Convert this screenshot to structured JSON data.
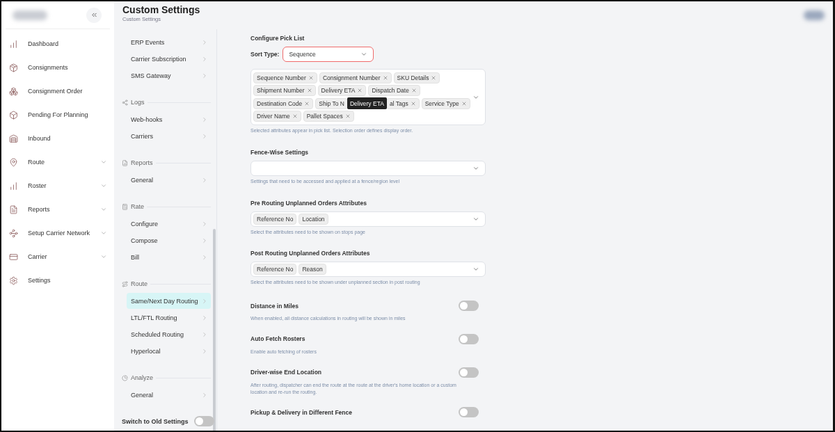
{
  "header": {
    "title": "Custom Settings",
    "breadcrumb": "Custom Settings"
  },
  "sidebar": {
    "items": [
      {
        "label": "Dashboard",
        "kind": "link"
      },
      {
        "label": "Consignments",
        "kind": "link"
      },
      {
        "label": "Consignment Order",
        "kind": "link"
      },
      {
        "label": "Pending For Planning",
        "kind": "link"
      },
      {
        "label": "Inbound",
        "kind": "link"
      },
      {
        "label": "Route",
        "kind": "group"
      },
      {
        "label": "Roster",
        "kind": "group"
      },
      {
        "label": "Reports",
        "kind": "group"
      },
      {
        "label": "Setup Carrier Network",
        "kind": "group"
      },
      {
        "label": "Carrier",
        "kind": "group"
      },
      {
        "label": "Settings",
        "kind": "link"
      }
    ]
  },
  "settings_menu": {
    "groups": [
      {
        "items": [
          {
            "label": "ERP Events",
            "selected": false
          },
          {
            "label": "Carrier Subscription",
            "selected": false
          },
          {
            "label": "SMS Gateway",
            "selected": false
          }
        ]
      },
      {
        "title": "Logs",
        "items": [
          {
            "label": "Web-hooks",
            "selected": false
          },
          {
            "label": "Carriers",
            "selected": false
          }
        ]
      },
      {
        "title": "Reports",
        "items": [
          {
            "label": "General",
            "selected": false
          }
        ]
      },
      {
        "title": "Rate",
        "items": [
          {
            "label": "Configure",
            "selected": false
          },
          {
            "label": "Compose",
            "selected": false
          },
          {
            "label": "Bill",
            "selected": false
          }
        ]
      },
      {
        "title": "Route",
        "items": [
          {
            "label": "Same/Next Day Routing",
            "selected": true
          },
          {
            "label": "LTL/FTL Routing",
            "selected": false
          },
          {
            "label": "Scheduled Routing",
            "selected": false
          },
          {
            "label": "Hyperlocal",
            "selected": false
          }
        ]
      },
      {
        "title": "Analyze",
        "items": [
          {
            "label": "General",
            "selected": false
          }
        ]
      }
    ],
    "old_settings": {
      "label": "Switch to Old Settings",
      "on": false
    }
  },
  "pick_list": {
    "title": "Configure Pick List",
    "sort_label": "Sort Type:",
    "sort_value": "Sequence",
    "rows": [
      [
        {
          "label": "Sequence Number",
          "removable": true
        },
        {
          "label": "Consignment Number",
          "removable": true
        },
        {
          "label": "SKU Details",
          "removable": true
        }
      ],
      [
        {
          "label": "Shipment Number",
          "removable": true
        },
        {
          "label": "Delivery ETA",
          "removable": true
        },
        {
          "label": "Dispatch Date",
          "removable": true
        }
      ],
      [
        {
          "label": "Destination Code",
          "removable": true
        },
        {
          "label": "Ship To N",
          "removable": false
        },
        {
          "kind": "tooltip",
          "label": "Delivery ETA"
        },
        {
          "label": "al Tags",
          "removable": true
        },
        {
          "label": "Service Type",
          "removable": true
        }
      ],
      [
        {
          "label": "Driver Name",
          "removable": true
        },
        {
          "label": "Pallet Spaces",
          "removable": true
        }
      ]
    ],
    "hint": "Selected attributes appear in pick list. Selection order defines display order."
  },
  "fence": {
    "title": "Fence-Wise Settings",
    "hint": "Settings that need to be accessed and applied at a fence/region level"
  },
  "attributes": [
    {
      "title": "Pre Routing Unplanned Orders Attributes",
      "chips": [
        "Reference No",
        "Location"
      ],
      "hint": "Select the attributes need to be shown on stops page"
    },
    {
      "title": "Post Routing Unplanned Orders Attributes",
      "chips": [
        "Reference No",
        "Reason"
      ],
      "hint": "Select the attributes need to be shown under unplanned section in post routing"
    }
  ],
  "toggles": [
    {
      "title": "Distance in Miles",
      "on": false,
      "description": "When enabled, all distance calculations in routing will be shown in miles"
    },
    {
      "title": "Auto Fetch Rosters",
      "on": false,
      "description": "Enable auto fetching of rosters"
    },
    {
      "title": "Driver-wise End Location",
      "on": false,
      "description": "After routing, dispatcher can end the route at the route at the driver's home location or a custom location and re-run the routing."
    },
    {
      "title": "Pickup & Delivery in Different Fence",
      "on": false
    }
  ]
}
